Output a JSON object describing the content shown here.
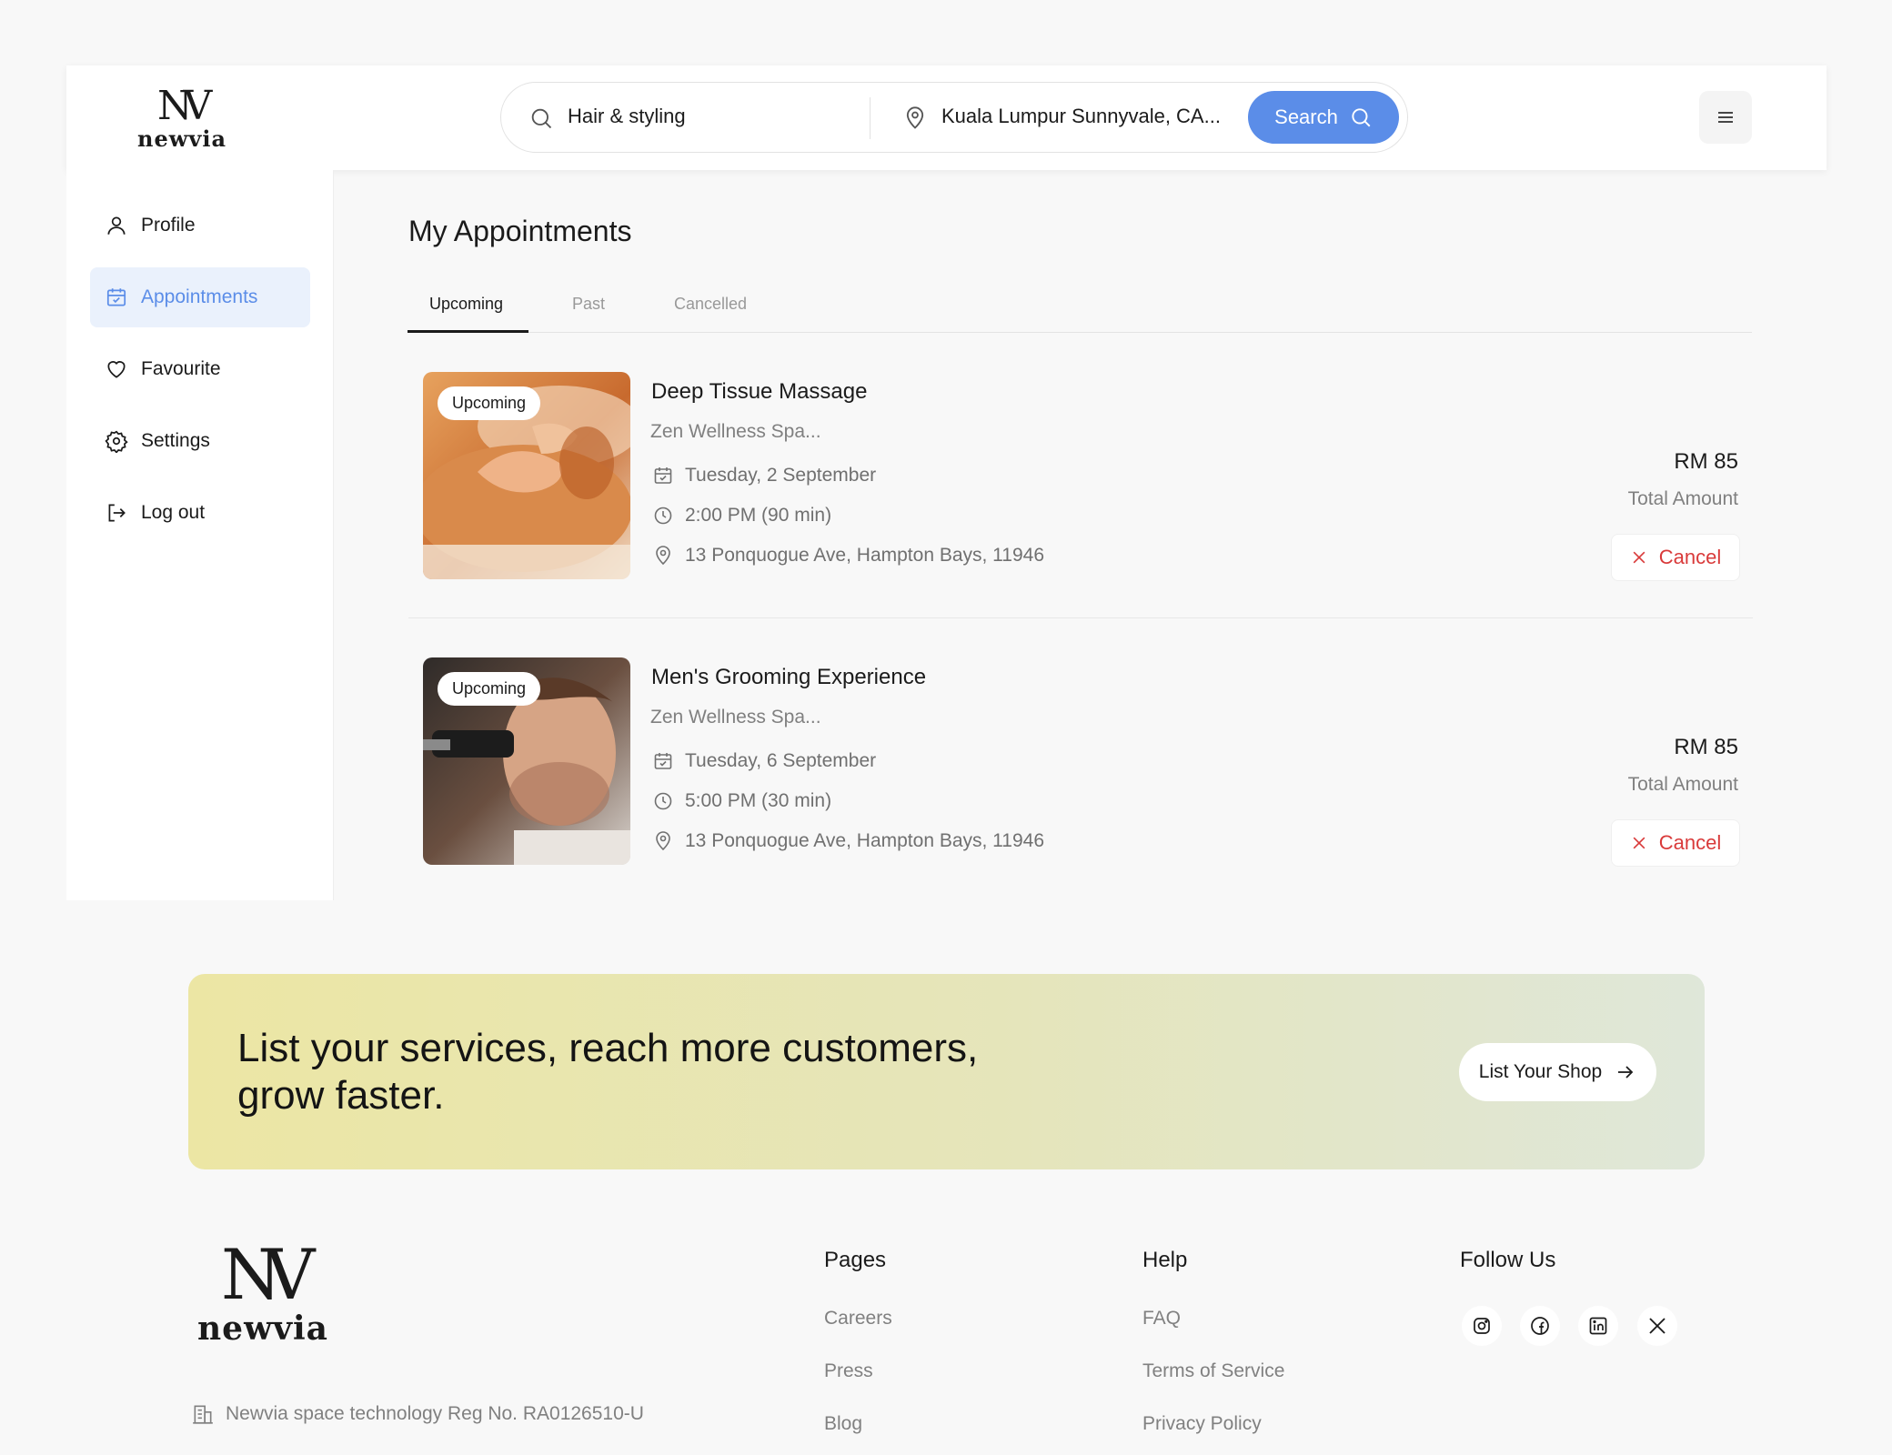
{
  "header": {
    "logo_word": "newvia",
    "search_service": "Hair & styling",
    "search_location": "Kuala Lumpur Sunnyvale, CA...",
    "search_button": "Search"
  },
  "sidebar": {
    "items": [
      {
        "label": "Profile"
      },
      {
        "label": "Appointments"
      },
      {
        "label": "Favourite"
      },
      {
        "label": "Settings"
      },
      {
        "label": "Log out"
      }
    ]
  },
  "main": {
    "title": "My Appointments",
    "tabs": [
      {
        "label": "Upcoming"
      },
      {
        "label": "Past"
      },
      {
        "label": "Cancelled"
      }
    ],
    "appointments": [
      {
        "status": "Upcoming",
        "title": "Deep Tissue Massage",
        "shop": "Zen Wellness Spa...",
        "date": "Tuesday, 2 September",
        "time": "2:00 PM (90 min)",
        "address": "13 Ponquogue Ave, Hampton Bays, 11946",
        "price": "RM 85",
        "price_label": "Total Amount",
        "cancel_label": "Cancel"
      },
      {
        "status": "Upcoming",
        "title": "Men's Grooming Experience",
        "shop": "Zen Wellness Spa...",
        "date": "Tuesday, 6 September",
        "time": "5:00 PM (30 min)",
        "address": "13 Ponquogue Ave, Hampton Bays, 11946",
        "price": "RM 85",
        "price_label": "Total Amount",
        "cancel_label": "Cancel"
      }
    ]
  },
  "banner": {
    "line1": "List your services, reach more customers,",
    "line2": "grow faster.",
    "button": "List Your Shop"
  },
  "footer": {
    "logo_word": "newvia",
    "reg": "Newvia space technology Reg No. RA0126510-U",
    "pages": {
      "heading": "Pages",
      "links": [
        "Careers",
        "Press",
        "Blog"
      ]
    },
    "help": {
      "heading": "Help",
      "links": [
        "FAQ",
        "Terms of Service",
        "Privacy Policy"
      ]
    },
    "follow": {
      "heading": "Follow Us",
      "icons": [
        "instagram-icon",
        "facebook-icon",
        "linkedin-icon",
        "x-icon"
      ]
    }
  },
  "colors": {
    "accent": "#5b8de8",
    "active_bg": "#eaf1fc",
    "danger": "#d93a3a"
  }
}
